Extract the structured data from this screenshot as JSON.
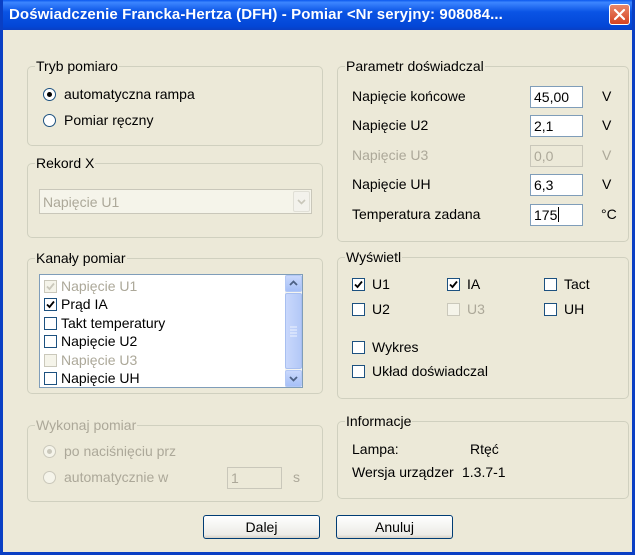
{
  "window": {
    "title": "Doświadczenie Francka-Hertza (DFH) - Pomiar  <Nr seryjny: 908084..."
  },
  "measurement_mode": {
    "legend": "Tryb pomiaro",
    "options": [
      "automatyczna rampa",
      "Pomiar ręczny"
    ],
    "selected": "automatyczna rampa"
  },
  "record_x": {
    "legend": "Rekord X",
    "selected": "Napięcie U1"
  },
  "channels": {
    "legend": "Kanały pomiar",
    "items": [
      {
        "label": "Napięcie U1",
        "checked": true,
        "enabled": false
      },
      {
        "label": "Prąd IA",
        "checked": true,
        "enabled": true
      },
      {
        "label": "Takt temperatury",
        "checked": false,
        "enabled": true
      },
      {
        "label": "Napięcie U2",
        "checked": false,
        "enabled": true
      },
      {
        "label": "Napięcie U3",
        "checked": false,
        "enabled": false
      },
      {
        "label": "Napięcie UH",
        "checked": false,
        "enabled": true
      }
    ]
  },
  "execute": {
    "legend": "Wykonaj pomiar",
    "option1": "po naciśnięciu prz",
    "option2": "automatycznie w",
    "interval": "1",
    "unit": "s"
  },
  "params": {
    "legend": "Parametr doświadczal",
    "rows": [
      {
        "label": "Napięcie końcowe",
        "value": "45,00",
        "unit": "V",
        "enabled": true
      },
      {
        "label": "Napięcie U2",
        "value": "2,1",
        "unit": "V",
        "enabled": true
      },
      {
        "label": "Napięcie U3",
        "value": "0,0",
        "unit": "V",
        "enabled": false
      },
      {
        "label": "Napięcie UH",
        "value": "6,3",
        "unit": "V",
        "enabled": true
      },
      {
        "label": "Temperatura zadana",
        "value": "175",
        "unit": "°C",
        "enabled": true
      }
    ]
  },
  "display": {
    "legend": "Wyświetl",
    "u1": "U1",
    "ia": "IA",
    "tact": "Tact",
    "u2": "U2",
    "u3": "U3",
    "uh": "UH",
    "chart": "Wykres",
    "setup": "Układ doświadczal"
  },
  "info": {
    "legend": "Informacje",
    "lamp_label": "Lampa:",
    "lamp_value": "Rtęć",
    "version_label": "Wersja urządzer",
    "version_value": "1.3.7-1"
  },
  "buttons": {
    "next": "Dalej",
    "cancel": "Anuluj"
  }
}
